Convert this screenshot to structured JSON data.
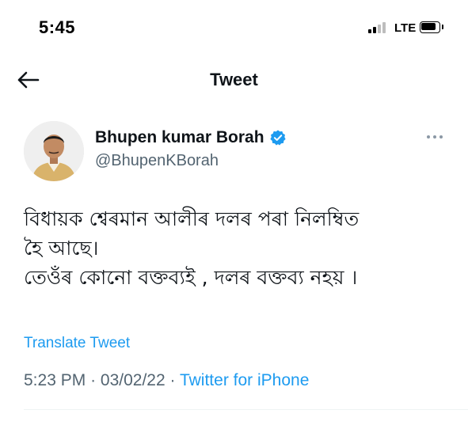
{
  "status_bar": {
    "time": "5:45",
    "network": "LTE"
  },
  "nav": {
    "title": "Tweet"
  },
  "tweet": {
    "author": {
      "name": "Bhupen kumar Borah",
      "handle": "@BhupenKBorah"
    },
    "text_lines": [
      "বিধায়ক শ্বেৰমান আলীৰ দলৰ পৰা নিলম্বিত",
      "হৈ আছে।",
      "তেওঁৰ কোনো বক্তব্যই , দলৰ বক্তব্য নহয় ।"
    ],
    "translate_label": "Translate Tweet",
    "time": "5:23 PM",
    "separator": "·",
    "date": "03/02/22",
    "source": "Twitter for iPhone"
  },
  "colors": {
    "accent": "#1d9bf0",
    "secondary_text": "#536471",
    "primary_text": "#0f1419"
  }
}
